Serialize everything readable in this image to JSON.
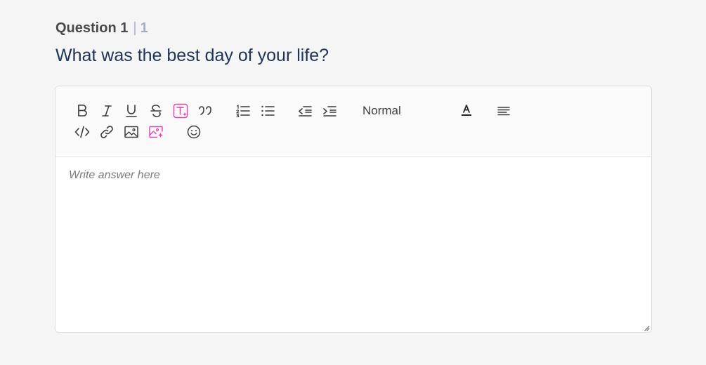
{
  "question": {
    "label": "Question 1",
    "separator": "|",
    "number": "1",
    "text": "What was the best day of your life?"
  },
  "toolbar": {
    "row1": [
      "bold-icon",
      "italic-icon",
      "underline-icon",
      "strikethrough-icon",
      "ai-text-icon",
      "blockquote-icon",
      "ordered-list-icon",
      "bullet-list-icon",
      "outdent-icon",
      "indent-icon",
      "text-color-icon",
      "align-left-icon"
    ],
    "row2": [
      "code-icon",
      "link-icon",
      "image-icon",
      "ai-image-icon",
      "emoji-icon"
    ],
    "style_select": "Normal"
  },
  "colors": {
    "accent": "#e040b0",
    "title": "#1f3357"
  },
  "answer": {
    "placeholder": "Write answer here",
    "value": ""
  }
}
